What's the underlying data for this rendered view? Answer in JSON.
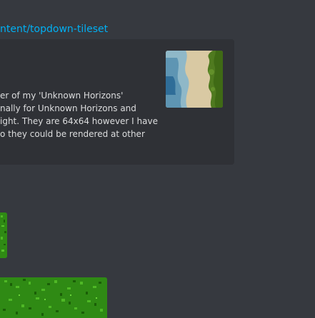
{
  "link": {
    "text": "ntent/topdown-tileset"
  },
  "embed": {
    "description_lines": [
      "er of my 'Unknown Horizons'",
      "nally for Unknown Horizons and",
      "ight. They are 64x64 however I have",
      "o they could be rendered at other"
    ]
  },
  "thumbnail": {
    "subject": "topdown-tileset-preview"
  },
  "colors": {
    "background": "#36393f",
    "embed_background": "#2f3136",
    "link": "#00b0f4",
    "text": "#dcddde",
    "grass": "#2f8a14"
  }
}
